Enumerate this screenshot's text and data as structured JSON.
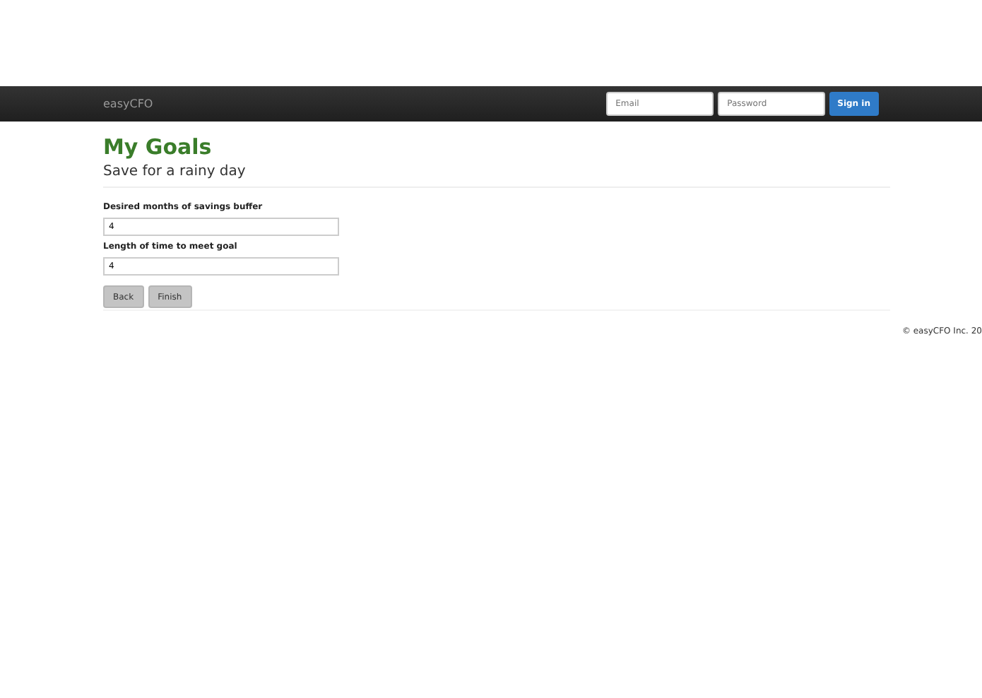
{
  "navbar": {
    "brand": "easyCFO",
    "email": {
      "placeholder": "Email"
    },
    "password": {
      "placeholder": "Password"
    },
    "sign_in": "Sign in"
  },
  "heading": "My Goals",
  "subtitle": "Save for a rainy day",
  "fields": [
    {
      "label": "Desired months of savings buffer",
      "value": "4"
    },
    {
      "label": "Length of time to meet goal",
      "value": "4"
    }
  ],
  "buttons": [
    "Back",
    "Finish"
  ],
  "footer": "© easyCFO Inc. 20"
}
